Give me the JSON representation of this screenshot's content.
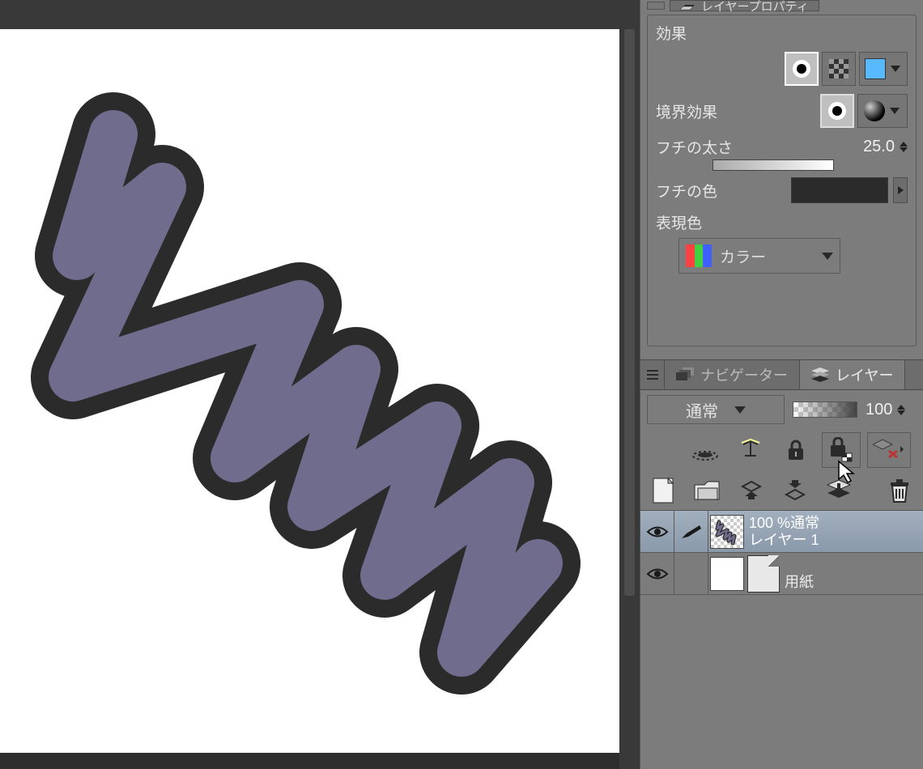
{
  "titlebar": {
    "label": "レイヤープロパティ"
  },
  "layer_property": {
    "section_effect": "効果",
    "boundary_effect_label": "境界効果",
    "thickness_label": "フチの太さ",
    "thickness_value": "25.0",
    "color_label": "フチの色",
    "border_color": "#2b2b2b",
    "expr_label": "表現色",
    "expr_value": "カラー"
  },
  "tabs": {
    "navigator": "ナビゲーター",
    "layer": "レイヤー"
  },
  "layer_panel": {
    "blend_mode": "通常",
    "opacity": "100",
    "layers": [
      {
        "opacity_line": "100 %通常",
        "name": "レイヤー 1"
      },
      {
        "name": "用紙"
      }
    ]
  },
  "canvas": {
    "stroke_color": "#706c8d",
    "outline_color": "#2b2b2b"
  }
}
